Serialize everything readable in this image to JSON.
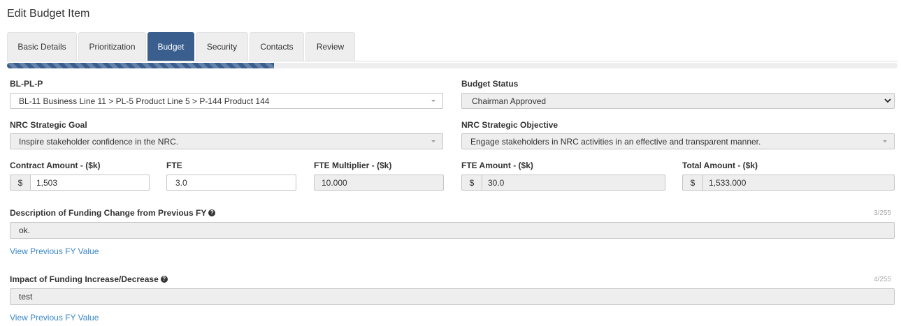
{
  "page_title": "Edit Budget Item",
  "tabs": [
    {
      "label": "Basic Details"
    },
    {
      "label": "Prioritization"
    },
    {
      "label": "Budget"
    },
    {
      "label": "Security"
    },
    {
      "label": "Contacts"
    },
    {
      "label": "Review"
    }
  ],
  "active_tab": "Budget",
  "progress": {
    "percent": 30
  },
  "colors": {
    "accent": "#3a5f8f",
    "link": "#3b87c6",
    "readonly_bg": "#eeeeee"
  },
  "bl_pl_p": {
    "label": "BL-PL-P",
    "value": "BL-11 Business Line 11 > PL-5 Product Line 5 > P-144 Product 144"
  },
  "budget_status": {
    "label": "Budget Status",
    "value": "Chairman Approved"
  },
  "strategic_goal": {
    "label": "NRC Strategic Goal",
    "value": "Inspire stakeholder confidence in the NRC."
  },
  "strategic_objective": {
    "label": "NRC Strategic Objective",
    "value": "Engage stakeholders in NRC activities in an effective and transparent manner."
  },
  "contract_amount": {
    "label": "Contract Amount - ($k)",
    "prefix": "$",
    "value": "1,503"
  },
  "fte": {
    "label": "FTE",
    "value": "3.0"
  },
  "fte_multiplier": {
    "label": "FTE Multiplier - ($k)",
    "value": "10.000"
  },
  "fte_amount": {
    "label": "FTE Amount - ($k)",
    "prefix": "$",
    "value": "30.0"
  },
  "total_amount": {
    "label": "Total Amount - ($k)",
    "prefix": "$",
    "value": "1,533.000"
  },
  "funding_change": {
    "label": "Description of Funding Change from Previous FY",
    "help_glyph": "?",
    "counter": "3/255",
    "value": "ok.",
    "link_label": "View Previous FY Value"
  },
  "funding_impact": {
    "label": "Impact of Funding Increase/Decrease",
    "help_glyph": "?",
    "counter": "4/255",
    "value": "test",
    "link_label": "View Previous FY Value"
  }
}
